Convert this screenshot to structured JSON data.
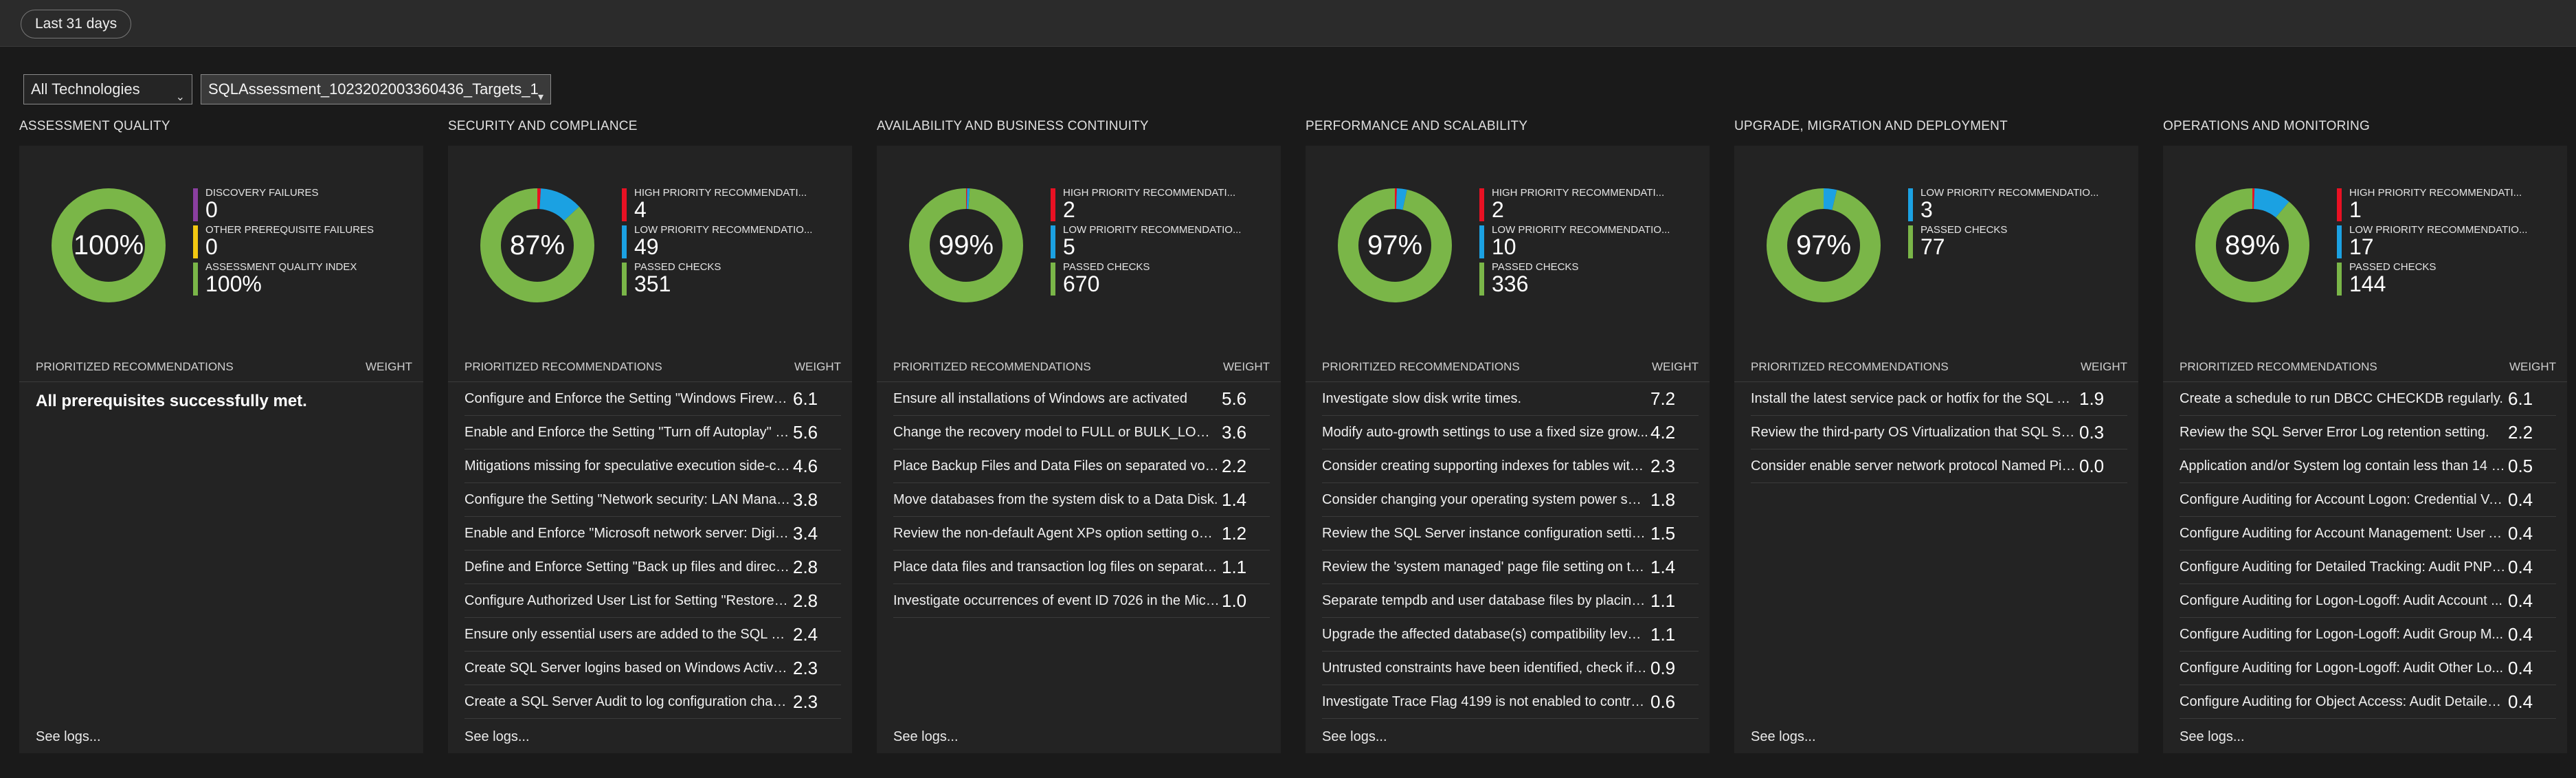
{
  "time_range": "Last 31 days",
  "filters": {
    "technology": "All Technologies",
    "target": "SQLAssessment_1023202003360436_Targets_1"
  },
  "colors": {
    "passed": "#7ab648",
    "high": "#e81123",
    "low": "#1ba1e2",
    "purple": "#8a3fa0",
    "yellow": "#f2c811"
  },
  "columns_header_label": "PRIORITIZED RECOMMENDATIONS",
  "weight_label": "WEIGHT",
  "see_logs": "See logs...",
  "panels": [
    {
      "title": "ASSESSMENT QUALITY",
      "percent": "100%",
      "legend": [
        {
          "label": "DISCOVERY FAILURES",
          "value": "0",
          "color": "#8a3fa0"
        },
        {
          "label": "OTHER PREREQUISITE FAILURES",
          "value": "0",
          "color": "#f2c811"
        },
        {
          "label": "ASSESSMENT QUALITY INDEX",
          "value": "100%",
          "color": "#7ab648"
        }
      ],
      "donut": [
        {
          "value": 100,
          "color": "#7ab648"
        }
      ],
      "empty_message": "All prerequisites successfully met.",
      "rows": []
    },
    {
      "title": "SECURITY AND COMPLIANCE",
      "percent": "87%",
      "legend": [
        {
          "label": "HIGH PRIORITY RECOMMENDATI...",
          "value": "4",
          "color": "#e81123"
        },
        {
          "label": "LOW PRIORITY RECOMMENDATIO...",
          "value": "49",
          "color": "#1ba1e2"
        },
        {
          "label": "PASSED CHECKS",
          "value": "351",
          "color": "#7ab648"
        }
      ],
      "donut": [
        {
          "value": 4,
          "color": "#e81123"
        },
        {
          "value": 49,
          "color": "#1ba1e2"
        },
        {
          "value": 351,
          "color": "#7ab648"
        }
      ],
      "empty_message": "",
      "rows": [
        {
          "text": "Configure and Enforce the Setting \"Windows Firewall...",
          "weight": "6.1"
        },
        {
          "text": "Enable and Enforce the Setting \"Turn off Autoplay\" vi...",
          "weight": "5.6"
        },
        {
          "text": "Mitigations missing for speculative execution side-ch...",
          "weight": "4.6"
        },
        {
          "text": "Configure the Setting \"Network security: LAN Manag...",
          "weight": "3.8"
        },
        {
          "text": "Enable and Enforce \"Microsoft network server: Digita...",
          "weight": "3.4"
        },
        {
          "text": "Define and Enforce Setting \"Back up files and directo...",
          "weight": "2.8"
        },
        {
          "text": "Configure Authorized User List for Setting \"Restore fi...",
          "weight": "2.8"
        },
        {
          "text": "Ensure only essential users are added to the SQL Ser...",
          "weight": "2.4"
        },
        {
          "text": "Create SQL Server logins based on Windows Active ...",
          "weight": "2.3"
        },
        {
          "text": "Create a SQL Server Audit to log configuration chang...",
          "weight": "2.3"
        }
      ]
    },
    {
      "title": "AVAILABILITY AND BUSINESS CONTINUITY",
      "percent": "99%",
      "legend": [
        {
          "label": "HIGH PRIORITY RECOMMENDATI...",
          "value": "2",
          "color": "#e81123"
        },
        {
          "label": "LOW PRIORITY RECOMMENDATIO...",
          "value": "5",
          "color": "#1ba1e2"
        },
        {
          "label": "PASSED CHECKS",
          "value": "670",
          "color": "#7ab648"
        }
      ],
      "donut": [
        {
          "value": 2,
          "color": "#e81123"
        },
        {
          "value": 5,
          "color": "#1ba1e2"
        },
        {
          "value": 670,
          "color": "#7ab648"
        }
      ],
      "empty_message": "",
      "rows": [
        {
          "text": "Ensure all installations of Windows are activated",
          "weight": "5.6"
        },
        {
          "text": "Change the recovery model to FULL or BULK_LOGGED.",
          "weight": "3.6"
        },
        {
          "text": "Place Backup Files and Data Files on separated volu...",
          "weight": "2.2"
        },
        {
          "text": "Move databases from the system disk to a Data Disk.",
          "weight": "1.4"
        },
        {
          "text": "Review the non-default Agent XPs option setting on ...",
          "weight": "1.2"
        },
        {
          "text": "Place data files and transaction log files on separate ...",
          "weight": "1.1"
        },
        {
          "text": "Investigate occurrences of event ID 7026 in the Micr...",
          "weight": "1.0"
        }
      ]
    },
    {
      "title": "PERFORMANCE AND SCALABILITY",
      "percent": "97%",
      "legend": [
        {
          "label": "HIGH PRIORITY RECOMMENDATI...",
          "value": "2",
          "color": "#e81123"
        },
        {
          "label": "LOW PRIORITY RECOMMENDATIO...",
          "value": "10",
          "color": "#1ba1e2"
        },
        {
          "label": "PASSED CHECKS",
          "value": "336",
          "color": "#7ab648"
        }
      ],
      "donut": [
        {
          "value": 2,
          "color": "#e81123"
        },
        {
          "value": 10,
          "color": "#1ba1e2"
        },
        {
          "value": 336,
          "color": "#7ab648"
        }
      ],
      "empty_message": "",
      "rows": [
        {
          "text": "Investigate slow disk write times.",
          "weight": "7.2"
        },
        {
          "text": "Modify auto-growth settings to use a fixed size grow...",
          "weight": "4.2"
        },
        {
          "text": "Consider creating supporting indexes for tables with ...",
          "weight": "2.3"
        },
        {
          "text": "Consider changing your operating system power savi...",
          "weight": "1.8"
        },
        {
          "text": "Review the SQL Server instance configuration setting...",
          "weight": "1.5"
        },
        {
          "text": "Review the 'system managed' page file setting on th...",
          "weight": "1.4"
        },
        {
          "text": "Separate tempdb and user database files by placing t...",
          "weight": "1.1"
        },
        {
          "text": "Upgrade the affected database(s) compatibility level ...",
          "weight": "1.1"
        },
        {
          "text": "Untrusted constraints have been identified, check if y...",
          "weight": "0.9"
        },
        {
          "text": "Investigate Trace Flag 4199 is not enabled to control ...",
          "weight": "0.6"
        }
      ]
    },
    {
      "title": "UPGRADE, MIGRATION AND DEPLOYMENT",
      "percent": "97%",
      "legend": [
        {
          "label": "LOW PRIORITY RECOMMENDATIO...",
          "value": "3",
          "color": "#1ba1e2"
        },
        {
          "label": "PASSED CHECKS",
          "value": "77",
          "color": "#7ab648"
        }
      ],
      "donut": [
        {
          "value": 3,
          "color": "#1ba1e2"
        },
        {
          "value": 77,
          "color": "#7ab648"
        }
      ],
      "empty_message": "",
      "rows": [
        {
          "text": "Install the latest service pack or hotfix for the SQL Se...",
          "weight": "1.9"
        },
        {
          "text": "Review the third-party OS Virtualization that SQL Ser...",
          "weight": "0.3"
        },
        {
          "text": "Consider enable server network protocol Named Pip...",
          "weight": "0.0"
        }
      ]
    },
    {
      "title": "OPERATIONS AND MONITORING",
      "percent": "89%",
      "legend": [
        {
          "label": "HIGH PRIORITY RECOMMENDATI...",
          "value": "1",
          "color": "#e81123"
        },
        {
          "label": "LOW PRIORITY RECOMMENDATIO...",
          "value": "17",
          "color": "#1ba1e2"
        },
        {
          "label": "PASSED CHECKS",
          "value": "144",
          "color": "#7ab648"
        }
      ],
      "donut": [
        {
          "value": 1,
          "color": "#e81123"
        },
        {
          "value": 17,
          "color": "#1ba1e2"
        },
        {
          "value": 144,
          "color": "#7ab648"
        }
      ],
      "empty_message": "",
      "rows": [
        {
          "text": "Create a schedule to run DBCC CHECKDB regularly.",
          "weight": "6.1"
        },
        {
          "text": "Review the SQL Server Error Log retention setting.",
          "weight": "2.2"
        },
        {
          "text": "Application and/or System log contain less than 14 d...",
          "weight": "0.5"
        },
        {
          "text": "Configure Auditing for Account Logon: Credential Va...",
          "weight": "0.4"
        },
        {
          "text": "Configure Auditing for Account Management: User A...",
          "weight": "0.4"
        },
        {
          "text": "Configure Auditing for Detailed Tracking: Audit PNP ...",
          "weight": "0.4"
        },
        {
          "text": "Configure Auditing for Logon-Logoff: Audit Account ...",
          "weight": "0.4"
        },
        {
          "text": "Configure Auditing for Logon-Logoff: Audit Group M...",
          "weight": "0.4"
        },
        {
          "text": "Configure Auditing for Logon-Logoff: Audit Other Lo...",
          "weight": "0.4"
        },
        {
          "text": "Configure Auditing for Object Access: Audit Detailed ...",
          "weight": "0.4"
        }
      ]
    }
  ]
}
